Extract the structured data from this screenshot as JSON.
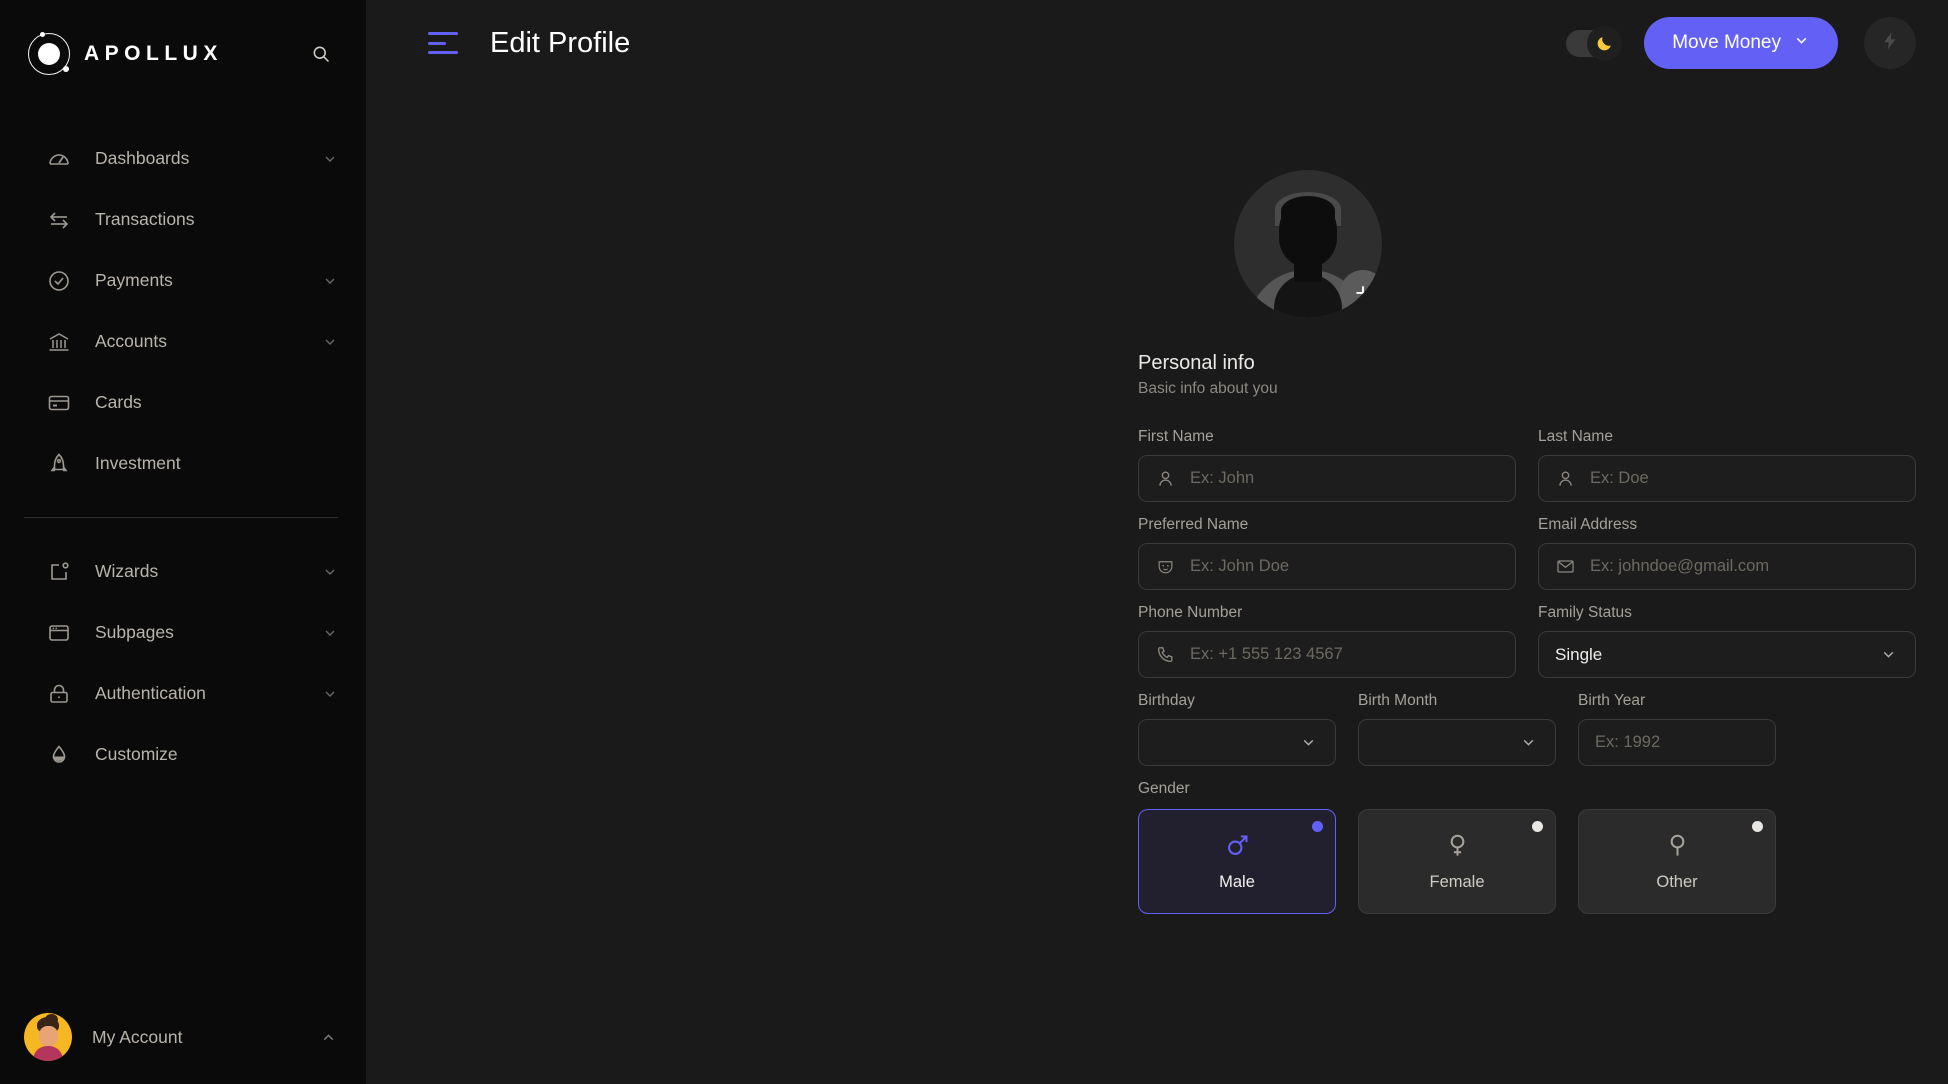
{
  "brand": {
    "name": "APOLLUX",
    "logo_icon": "orbit-logo-icon",
    "search_icon": "search-icon"
  },
  "sidebar": {
    "items": [
      {
        "label": "Dashboards",
        "icon": "speedometer-icon",
        "chevron": true
      },
      {
        "label": "Transactions",
        "icon": "transfer-arrows-icon",
        "chevron": false
      },
      {
        "label": "Payments",
        "icon": "check-circle-icon",
        "chevron": true
      },
      {
        "label": "Accounts",
        "icon": "bank-icon",
        "chevron": true
      },
      {
        "label": "Cards",
        "icon": "credit-card-icon",
        "chevron": false
      },
      {
        "label": "Investment",
        "icon": "rocket-icon",
        "chevron": false
      }
    ],
    "items_secondary": [
      {
        "label": "Wizards",
        "icon": "wizard-square-icon",
        "chevron": true
      },
      {
        "label": "Subpages",
        "icon": "browser-window-icon",
        "chevron": true
      },
      {
        "label": "Authentication",
        "icon": "lock-icon",
        "chevron": true
      },
      {
        "label": "Customize",
        "icon": "droplet-icon",
        "chevron": false
      }
    ],
    "account": {
      "label": "My Account",
      "avatar": "user-avatar",
      "chevron_icon": "chevron-up-icon"
    }
  },
  "topbar": {
    "menu_icon": "hamburger-menu-icon",
    "title": "Edit Profile",
    "theme_toggle": {
      "icon": "moon-icon",
      "state": "dark"
    },
    "move_money": {
      "label": "Move Money",
      "chevron_icon": "chevron-down-icon"
    },
    "quick_action": {
      "icon": "lightning-bolt-icon"
    }
  },
  "profile": {
    "avatar": {
      "icon": "user-placeholder-avatar",
      "add_badge": "+"
    },
    "section": {
      "title": "Personal info",
      "subtitle": "Basic info about you"
    },
    "fields": {
      "first_name": {
        "label": "First Name",
        "placeholder": "Ex: John",
        "value": "",
        "icon": "user-icon"
      },
      "last_name": {
        "label": "Last Name",
        "placeholder": "Ex: Doe",
        "value": "",
        "icon": "user-icon"
      },
      "preferred": {
        "label": "Preferred Name",
        "placeholder": "Ex: John Doe",
        "value": "",
        "icon": "mask-icon"
      },
      "email": {
        "label": "Email Address",
        "placeholder": "Ex: johndoe@gmail.com",
        "value": "",
        "icon": "envelope-icon"
      },
      "phone": {
        "label": "Phone Number",
        "placeholder": "Ex: +1 555 123 4567",
        "value": "",
        "icon": "phone-icon"
      },
      "family": {
        "label": "Family Status",
        "value": "Single",
        "chevron_icon": "chevron-down-icon"
      },
      "birthday": {
        "label": "Birthday",
        "value": "",
        "chevron_icon": "chevron-down-icon"
      },
      "birth_month": {
        "label": "Birth Month",
        "value": "",
        "chevron_icon": "chevron-down-icon"
      },
      "birth_year": {
        "label": "Birth Year",
        "placeholder": "Ex: 1992",
        "value": ""
      }
    },
    "gender": {
      "label": "Gender",
      "options": [
        {
          "label": "Male",
          "icon": "mars-icon",
          "selected": true
        },
        {
          "label": "Female",
          "icon": "venus-icon",
          "selected": false
        },
        {
          "label": "Other",
          "icon": "genderless-icon",
          "selected": false
        }
      ]
    }
  },
  "colors": {
    "accent": "#6360F5",
    "sidebar_bg": "#0a0a0a",
    "main_bg": "#1a1a1a",
    "card_bg": "#2b2b2b",
    "moon": "#F5CB3A"
  }
}
